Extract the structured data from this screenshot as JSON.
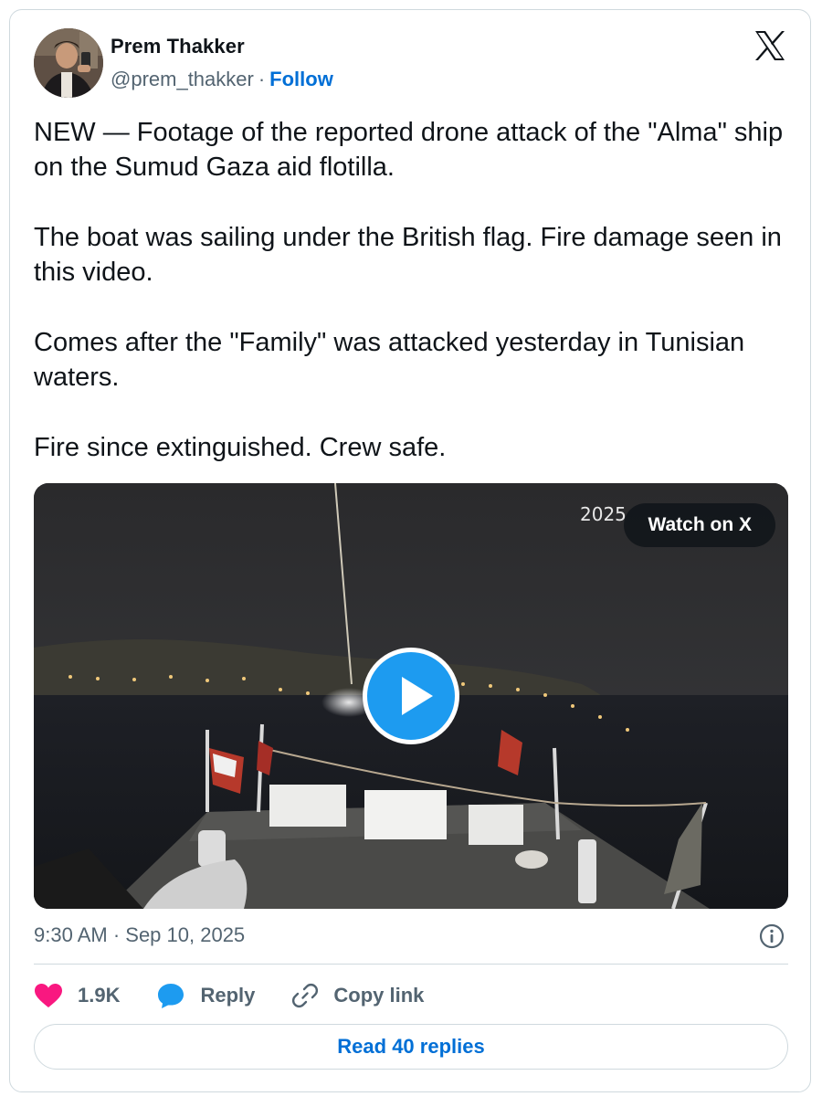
{
  "author": {
    "display_name": "Prem Thakker",
    "handle": "@prem_thakker",
    "separator": "·",
    "follow_label": "Follow",
    "avatar_icon": "user-avatar"
  },
  "brand": {
    "logo_icon": "x-logo-icon"
  },
  "tweet": {
    "paragraphs": [
      "NEW — Footage of the reported drone attack of the \"Alma\" ship on the Sumud Gaza aid flotilla.",
      "The boat was sailing under the British flag. Fire damage seen in this video.",
      "Comes after the \"Family\" was attacked yesterday in Tunisian waters.",
      "Fire since extinguished. Crew safe."
    ]
  },
  "media": {
    "type": "video",
    "video_stamp": "2025",
    "watch_label": "Watch on X",
    "play_icon": "play-icon"
  },
  "meta": {
    "timestamp": "9:30 AM · Sep 10, 2025",
    "info_icon": "info-icon"
  },
  "actions": {
    "likes_count": "1.9K",
    "reply_label": "Reply",
    "copy_link_label": "Copy link"
  },
  "footer": {
    "read_replies_label": "Read 40 replies"
  },
  "colors": {
    "link_blue": "#006fd6",
    "like_pink": "#f91880",
    "reply_blue": "#1d9bf0",
    "muted_text": "#536471",
    "border": "#cfd9de"
  }
}
